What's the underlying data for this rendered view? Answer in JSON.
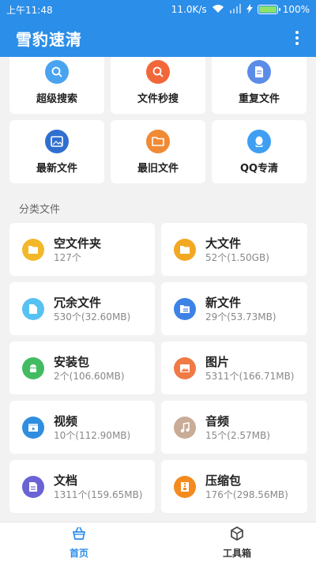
{
  "status_bar": {
    "time": "上午11:48",
    "network_speed": "11.0K/s",
    "battery_percent": "100%",
    "battery_level": 1.0
  },
  "app_bar": {
    "title": "雪豹速清",
    "menu_icon": "more-vert-icon"
  },
  "tools": [
    {
      "label": "超级搜索",
      "icon": "search-icon",
      "color": "#4aa3f0"
    },
    {
      "label": "文件秒搜",
      "icon": "search-icon",
      "color": "#f2673a"
    },
    {
      "label": "重复文件",
      "icon": "document-icon",
      "color": "#5b8de8"
    },
    {
      "label": "最新文件",
      "icon": "image-icon",
      "color": "#2f6fcf"
    },
    {
      "label": "最旧文件",
      "icon": "folder-open-icon",
      "color": "#f08a35"
    },
    {
      "label": "QQ专清",
      "icon": "qq-icon",
      "color": "#3e9ff2"
    }
  ],
  "section_title": "分类文件",
  "categories": [
    {
      "name": "空文件夹",
      "meta": "127个",
      "icon": "folder-icon",
      "color": "#f3b82a"
    },
    {
      "name": "大文件",
      "meta": "52个(1.50GB)",
      "icon": "folder-icon",
      "color": "#f3a823"
    },
    {
      "name": "冗余文件",
      "meta": "530个(32.60MB)",
      "icon": "file-icon",
      "color": "#57c2f2"
    },
    {
      "name": "新文件",
      "meta": "29个(53.73MB)",
      "icon": "folder-list-icon",
      "color": "#3d82e6"
    },
    {
      "name": "安装包",
      "meta": "2个(106.60MB)",
      "icon": "android-icon",
      "color": "#43bc61"
    },
    {
      "name": "图片",
      "meta": "5311个(166.71MB)",
      "icon": "image-icon",
      "color": "#f07a46"
    },
    {
      "name": "视频",
      "meta": "10个(112.90MB)",
      "icon": "video-icon",
      "color": "#2f8ee0"
    },
    {
      "name": "音频",
      "meta": "15个(2.57MB)",
      "icon": "music-icon",
      "color": "#c9ab96"
    },
    {
      "name": "文档",
      "meta": "1311个(159.65MB)",
      "icon": "document-icon",
      "color": "#6a63d6"
    },
    {
      "name": "压缩包",
      "meta": "176个(298.56MB)",
      "icon": "archive-icon",
      "color": "#f48b1f"
    }
  ],
  "bottom_nav": [
    {
      "label": "首页",
      "icon": "basket-icon",
      "active": true
    },
    {
      "label": "工具箱",
      "icon": "cube-icon",
      "active": false
    }
  ],
  "colors": {
    "primary": "#2b8ee8",
    "background": "#f2f2f2"
  }
}
